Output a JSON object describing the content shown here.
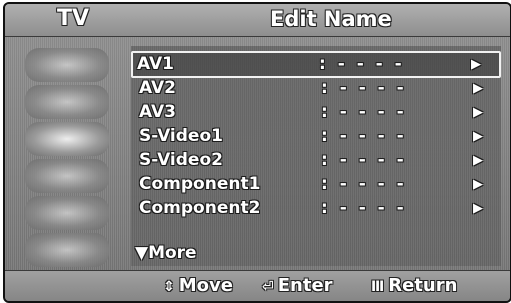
{
  "header": {
    "source_label": "TV",
    "title": "Edit Name"
  },
  "menu": {
    "items": [
      {
        "name": "AV1",
        "value": ": - - - -",
        "arrow": "▶"
      },
      {
        "name": "AV2",
        "value": ": - - - -",
        "arrow": "▶"
      },
      {
        "name": "AV3",
        "value": ": - - - -",
        "arrow": "▶"
      },
      {
        "name": "S-Video1",
        "value": ": - - - -",
        "arrow": "▶"
      },
      {
        "name": "S-Video2",
        "value": ": - - - -",
        "arrow": "▶"
      },
      {
        "name": "Component1",
        "value": ": - - - -",
        "arrow": "▶"
      },
      {
        "name": "Component2",
        "value": ": - - - -",
        "arrow": "▶"
      }
    ],
    "more_label": "▼More"
  },
  "footer": {
    "move": {
      "icon": "⇕",
      "label": "Move"
    },
    "enter": {
      "icon": "⏎",
      "label": "Enter"
    },
    "return": {
      "icon": "Ⅲ",
      "label": "Return"
    }
  },
  "sidebar": {
    "icons": [
      "picture-icon",
      "sound-icon",
      "channel-icon",
      "setup-icon",
      "input-icon",
      "application-icon"
    ]
  }
}
